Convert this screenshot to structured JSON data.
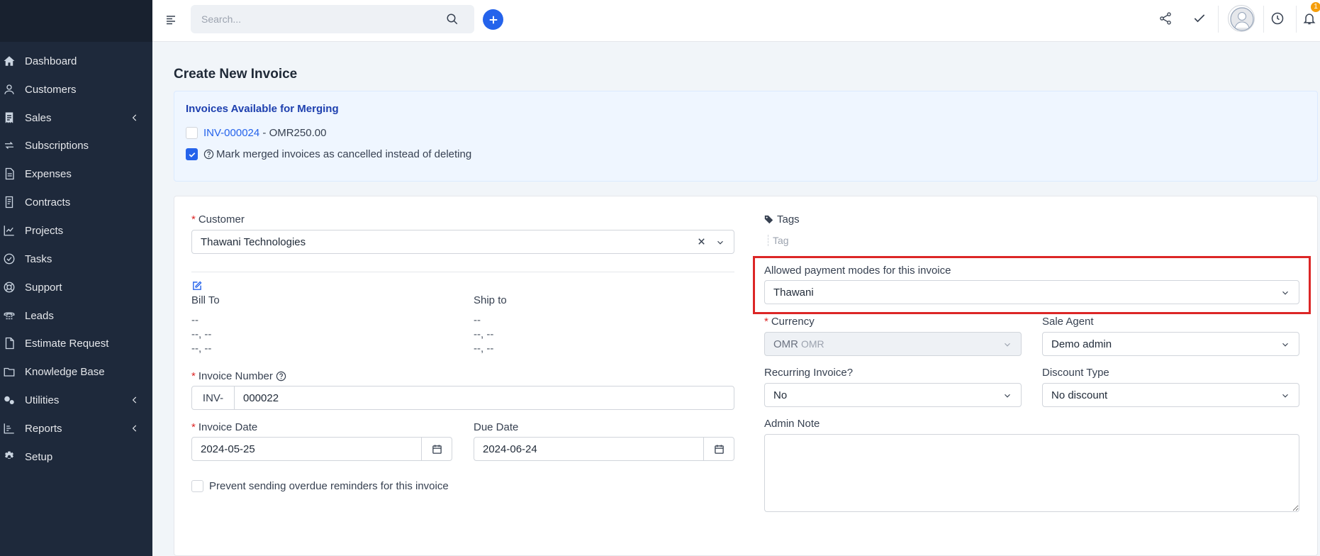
{
  "sidebar": {
    "items": [
      {
        "label": "Dashboard",
        "icon": "home-icon",
        "has_submenu": false
      },
      {
        "label": "Customers",
        "icon": "user-icon",
        "has_submenu": false
      },
      {
        "label": "Sales",
        "icon": "receipt-icon",
        "has_submenu": true
      },
      {
        "label": "Subscriptions",
        "icon": "refresh-icon",
        "has_submenu": false
      },
      {
        "label": "Expenses",
        "icon": "file-icon",
        "has_submenu": false
      },
      {
        "label": "Contracts",
        "icon": "contract-icon",
        "has_submenu": false
      },
      {
        "label": "Projects",
        "icon": "chart-icon",
        "has_submenu": false
      },
      {
        "label": "Tasks",
        "icon": "check-circle-icon",
        "has_submenu": false
      },
      {
        "label": "Support",
        "icon": "lifebuoy-icon",
        "has_submenu": false
      },
      {
        "label": "Leads",
        "icon": "tty-icon",
        "has_submenu": false
      },
      {
        "label": "Estimate Request",
        "icon": "document-icon",
        "has_submenu": false
      },
      {
        "label": "Knowledge Base",
        "icon": "folder-icon",
        "has_submenu": false
      },
      {
        "label": "Utilities",
        "icon": "cogs-icon",
        "has_submenu": true
      },
      {
        "label": "Reports",
        "icon": "bar-chart-icon",
        "has_submenu": true
      },
      {
        "label": "Setup",
        "icon": "gear-icon",
        "has_submenu": false
      }
    ]
  },
  "topbar": {
    "search_placeholder": "Search...",
    "notification_count": "1"
  },
  "page": {
    "title": "Create New Invoice"
  },
  "merge": {
    "title": "Invoices Available for Merging",
    "invoice_link": "INV-000024",
    "invoice_amount": " - OMR250.00",
    "invoice_checked": false,
    "cancel_label": "Mark merged invoices as cancelled instead of deleting",
    "cancel_checked": true
  },
  "form": {
    "customer_label": "Customer",
    "customer_value": "Thawani Technologies",
    "bill_to_label": "Bill To",
    "ship_to_label": "Ship to",
    "bill_to_lines": [
      "--",
      "--, --",
      "--, --"
    ],
    "ship_to_lines": [
      "--",
      "--, --",
      "--, --"
    ],
    "invoice_number_label": "Invoice Number",
    "invoice_prefix": "INV-",
    "invoice_number": "000022",
    "invoice_date_label": "Invoice Date",
    "invoice_date": "2024-05-25",
    "due_date_label": "Due Date",
    "due_date": "2024-06-24",
    "prevent_reminders_label": "Prevent sending overdue reminders for this invoice",
    "tags_label": "Tags",
    "tag_placeholder": "Tag",
    "payment_modes_label": "Allowed payment modes for this invoice",
    "payment_modes_value": "Thawani",
    "currency_label": "Currency",
    "currency_value": "OMR",
    "currency_symbol": "OMR",
    "sale_agent_label": "Sale Agent",
    "sale_agent_value": "Demo admin",
    "recurring_label": "Recurring Invoice?",
    "recurring_value": "No",
    "discount_type_label": "Discount Type",
    "discount_type_value": "No discount",
    "admin_note_label": "Admin Note",
    "admin_note_value": ""
  },
  "colors": {
    "sidebar_bg": "#1e293b",
    "accent": "#2563eb",
    "highlight": "#dc2626",
    "required": "#dc2626"
  }
}
